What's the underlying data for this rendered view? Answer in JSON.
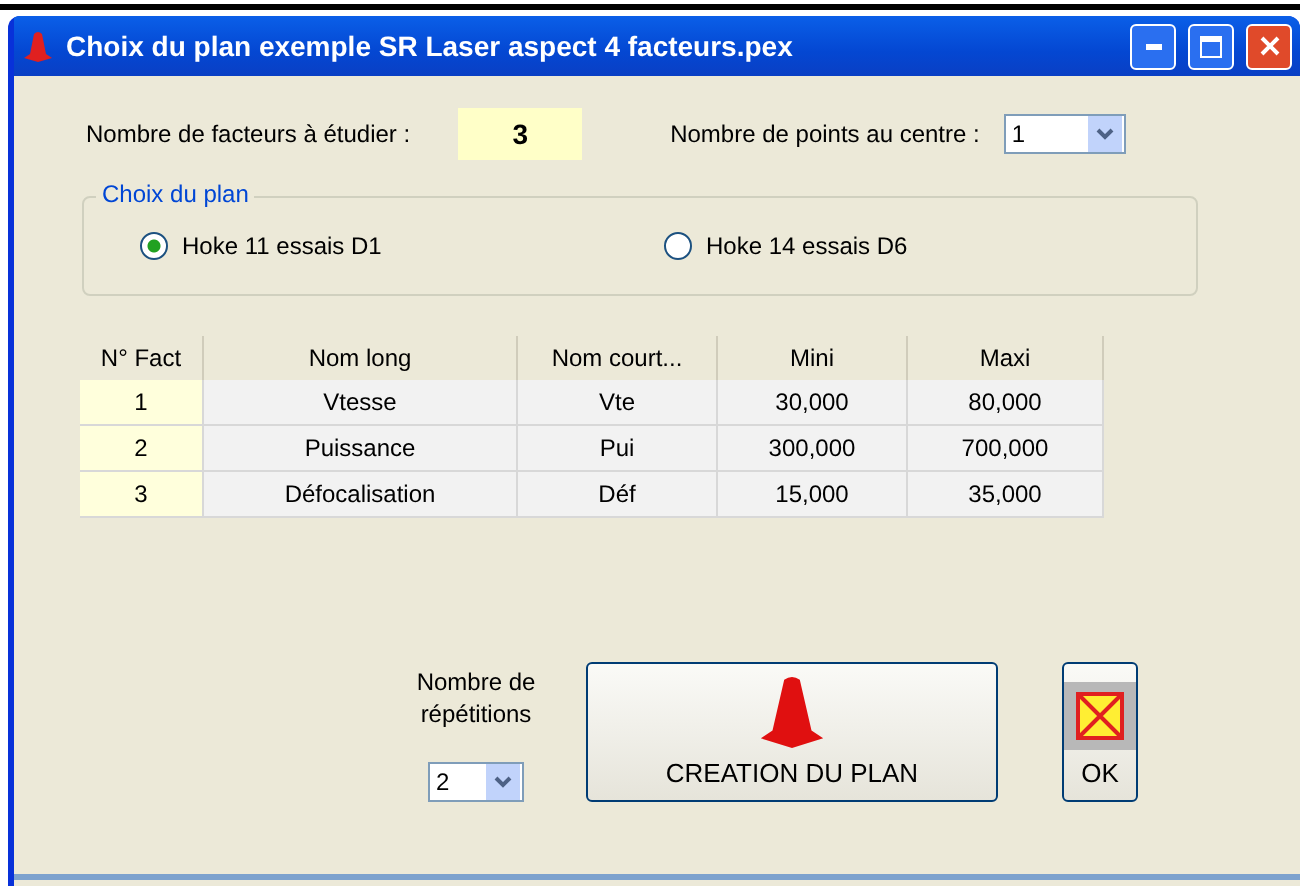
{
  "window": {
    "title": "Choix du plan exemple SR Laser aspect 4 facteurs.pex"
  },
  "factors_field": {
    "label": "Nombre de facteurs à étudier :",
    "value": "3"
  },
  "center_points": {
    "label": "Nombre de points au centre :",
    "value": "1"
  },
  "plan_group": {
    "title": "Choix du plan",
    "options": [
      {
        "label": "Hoke 11 essais D1",
        "selected": true
      },
      {
        "label": "Hoke 14 essais D6",
        "selected": false
      }
    ]
  },
  "table": {
    "columns": [
      "N° Fact",
      "Nom long",
      "Nom  court...",
      "Mini",
      "Maxi"
    ],
    "rows": [
      [
        "1",
        "Vtesse",
        "Vte",
        "30,000",
        "80,000"
      ],
      [
        "2",
        "Puissance",
        "Pui",
        "300,000",
        "700,000"
      ],
      [
        "3",
        "Défocalisation",
        "Déf",
        "15,000",
        "35,000"
      ]
    ]
  },
  "repetitions": {
    "label": "Nombre de répétitions",
    "value": "2"
  },
  "buttons": [
    {
      "kind": "create",
      "label": "CREATION DU PLAN"
    },
    {
      "kind": "ok",
      "label": "OK"
    }
  ]
}
